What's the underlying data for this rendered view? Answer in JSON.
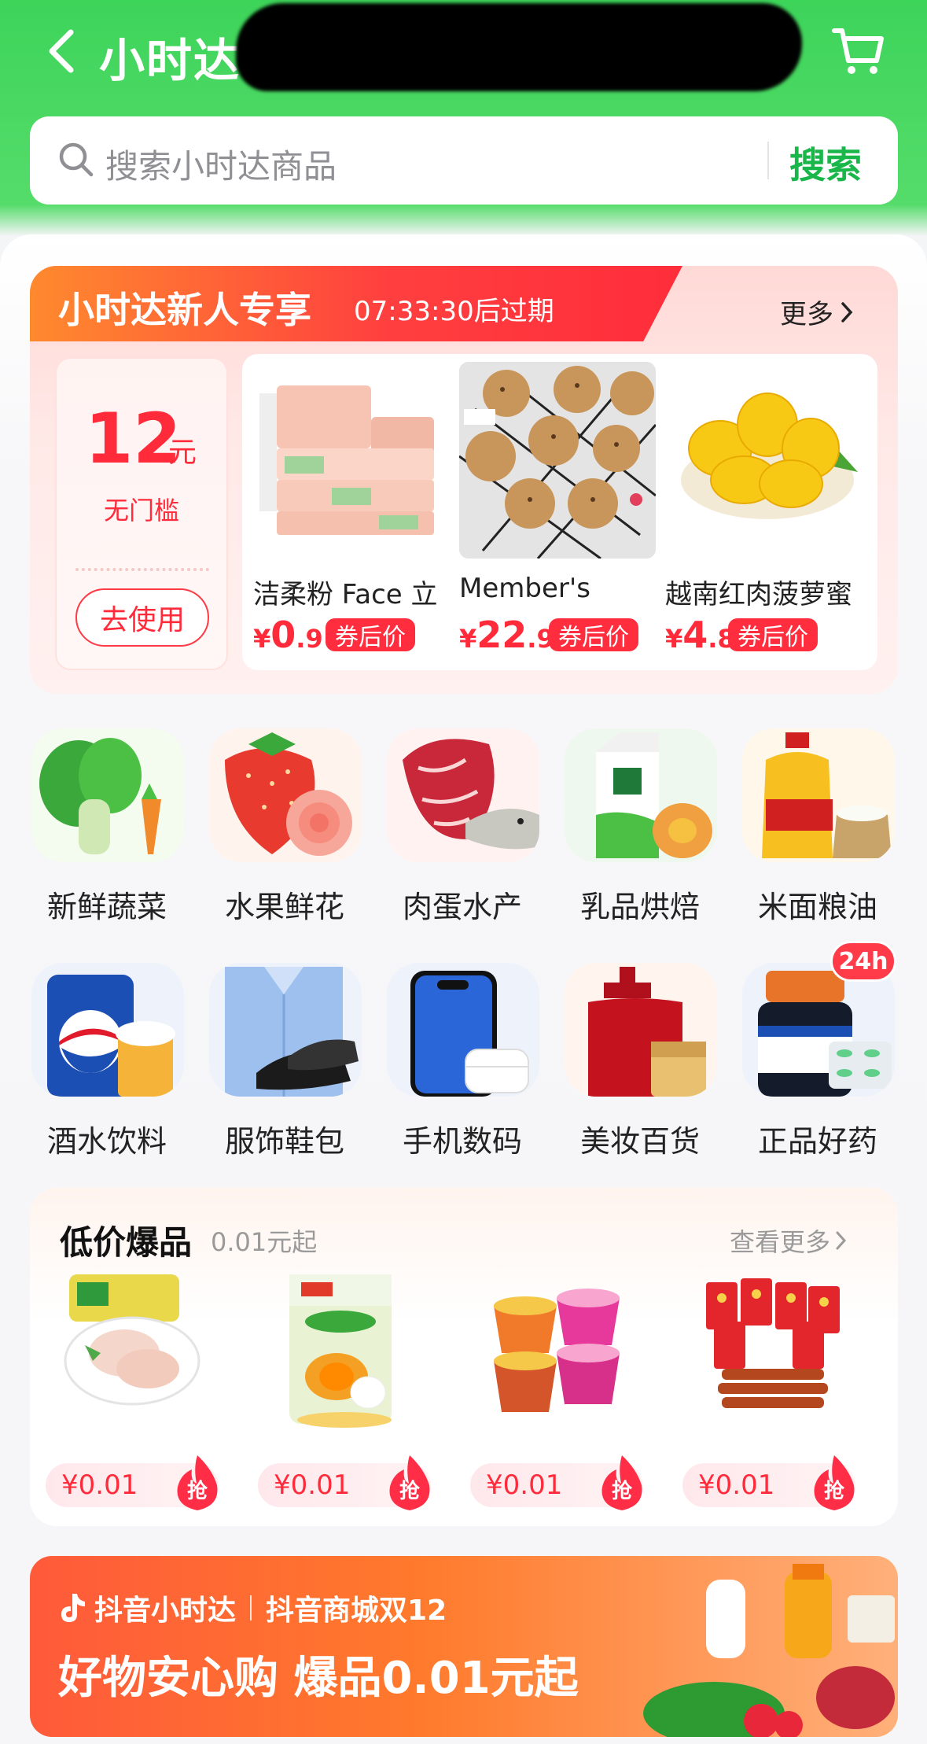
{
  "header": {
    "title": "小时达"
  },
  "search": {
    "placeholder": "搜索小时达商品",
    "button": "搜索"
  },
  "newcomer": {
    "title": "小时达新人专享",
    "expire": "07:33:30后过期",
    "more": "更多",
    "coupon": {
      "amount": "12",
      "unit": "元",
      "condition": "无门槛",
      "use_button": "去使用"
    },
    "products": [
      {
        "name": "洁柔粉 Face 立",
        "yen": "¥",
        "int": "0",
        "dec": ".9",
        "tag": "券后价"
      },
      {
        "name": "Member's",
        "yen": "¥",
        "int": "22",
        "dec": ".9",
        "tag": "券后价"
      },
      {
        "name": "越南红肉菠萝蜜",
        "yen": "¥",
        "int": "4",
        "dec": ".8",
        "tag": "券后价"
      }
    ]
  },
  "categories": [
    {
      "label": "新鲜蔬菜"
    },
    {
      "label": "水果鲜花"
    },
    {
      "label": "肉蛋水产"
    },
    {
      "label": "乳品烘焙"
    },
    {
      "label": "米面粮油"
    },
    {
      "label": "酒水饮料"
    },
    {
      "label": "服饰鞋包"
    },
    {
      "label": "手机数码"
    },
    {
      "label": "美妆百货"
    },
    {
      "label": "正品好药"
    }
  ],
  "badge_24h": "24h",
  "low_price": {
    "title": "低价爆品",
    "subtitle": "0.01元起",
    "more": "查看更多",
    "items": [
      {
        "price": "¥0.01",
        "grab": "抢"
      },
      {
        "price": "¥0.01",
        "grab": "抢"
      },
      {
        "price": "¥0.01",
        "grab": "抢"
      },
      {
        "price": "¥0.01",
        "grab": "抢"
      }
    ]
  },
  "banner": {
    "brand1": "抖音小时达",
    "brand2": "抖音商城双12",
    "headline": "好物安心购 爆品0.01元起"
  },
  "colors": {
    "brand_green": "#3dd45a",
    "search_green": "#19b64a",
    "accent_red": "#ff2b3a"
  }
}
